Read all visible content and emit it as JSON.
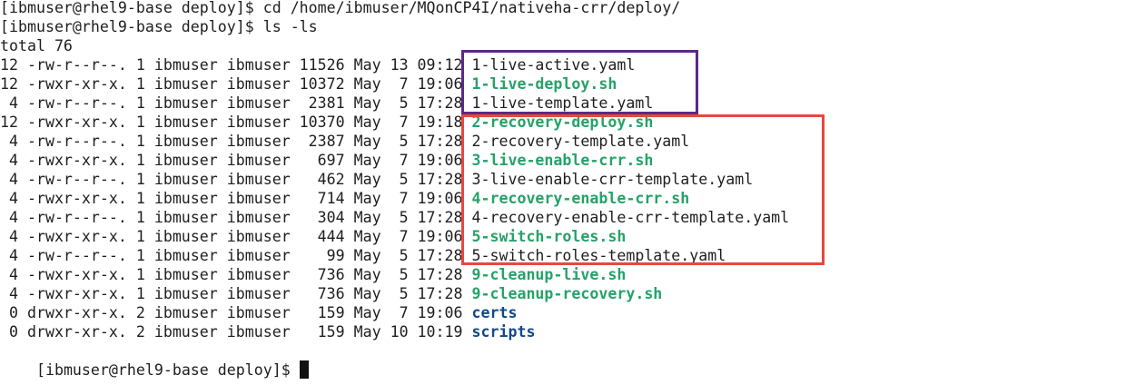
{
  "terminal": {
    "commands": [
      "[ibmuser@rhel9-base deploy]$ cd /home/ibmuser/MQonCP4I/nativeha-crr/deploy/",
      "[ibmuser@rhel9-base deploy]$ ls -ls"
    ],
    "total": "total 76",
    "files": [
      {
        "meta": "12 -rw-r--r--. 1 ibmuser ibmuser 11526 May 13 09:12 ",
        "name": "1-live-active.yaml",
        "type": "file"
      },
      {
        "meta": "12 -rwxr-xr-x. 1 ibmuser ibmuser 10372 May  7 19:06 ",
        "name": "1-live-deploy.sh",
        "type": "exec"
      },
      {
        "meta": " 4 -rw-r--r--. 1 ibmuser ibmuser  2381 May  5 17:28 ",
        "name": "1-live-template.yaml",
        "type": "file"
      },
      {
        "meta": "12 -rwxr-xr-x. 1 ibmuser ibmuser 10370 May  7 19:18 ",
        "name": "2-recovery-deploy.sh",
        "type": "exec"
      },
      {
        "meta": " 4 -rw-r--r--. 1 ibmuser ibmuser  2387 May  5 17:28 ",
        "name": "2-recovery-template.yaml",
        "type": "file"
      },
      {
        "meta": " 4 -rwxr-xr-x. 1 ibmuser ibmuser   697 May  7 19:06 ",
        "name": "3-live-enable-crr.sh",
        "type": "exec"
      },
      {
        "meta": " 4 -rw-r--r--. 1 ibmuser ibmuser   462 May  5 17:28 ",
        "name": "3-live-enable-crr-template.yaml",
        "type": "file"
      },
      {
        "meta": " 4 -rwxr-xr-x. 1 ibmuser ibmuser   714 May  7 19:06 ",
        "name": "4-recovery-enable-crr.sh",
        "type": "exec"
      },
      {
        "meta": " 4 -rw-r--r--. 1 ibmuser ibmuser   304 May  5 17:28 ",
        "name": "4-recovery-enable-crr-template.yaml",
        "type": "file"
      },
      {
        "meta": " 4 -rwxr-xr-x. 1 ibmuser ibmuser   444 May  7 19:06 ",
        "name": "5-switch-roles.sh",
        "type": "exec"
      },
      {
        "meta": " 4 -rw-r--r--. 1 ibmuser ibmuser    99 May  5 17:28 ",
        "name": "5-switch-roles-template.yaml",
        "type": "file"
      },
      {
        "meta": " 4 -rwxr-xr-x. 1 ibmuser ibmuser   736 May  5 17:28 ",
        "name": "9-cleanup-live.sh",
        "type": "exec"
      },
      {
        "meta": " 4 -rwxr-xr-x. 1 ibmuser ibmuser   736 May  5 17:28 ",
        "name": "9-cleanup-recovery.sh",
        "type": "exec"
      },
      {
        "meta": " 0 drwxr-xr-x. 2 ibmuser ibmuser   159 May  7 19:06 ",
        "name": "certs",
        "type": "dir"
      },
      {
        "meta": " 0 drwxr-xr-x. 2 ibmuser ibmuser   159 May 10 10:19 ",
        "name": "scripts",
        "type": "dir"
      }
    ],
    "prompt": "[ibmuser@rhel9-base deploy]$ "
  },
  "colors": {
    "text": "#1e1e1e",
    "executable": "#26a269",
    "directory": "#12488b",
    "highlight_purple": "#5b2a86",
    "highlight_red": "#e8473f",
    "background": "#ffffff"
  }
}
